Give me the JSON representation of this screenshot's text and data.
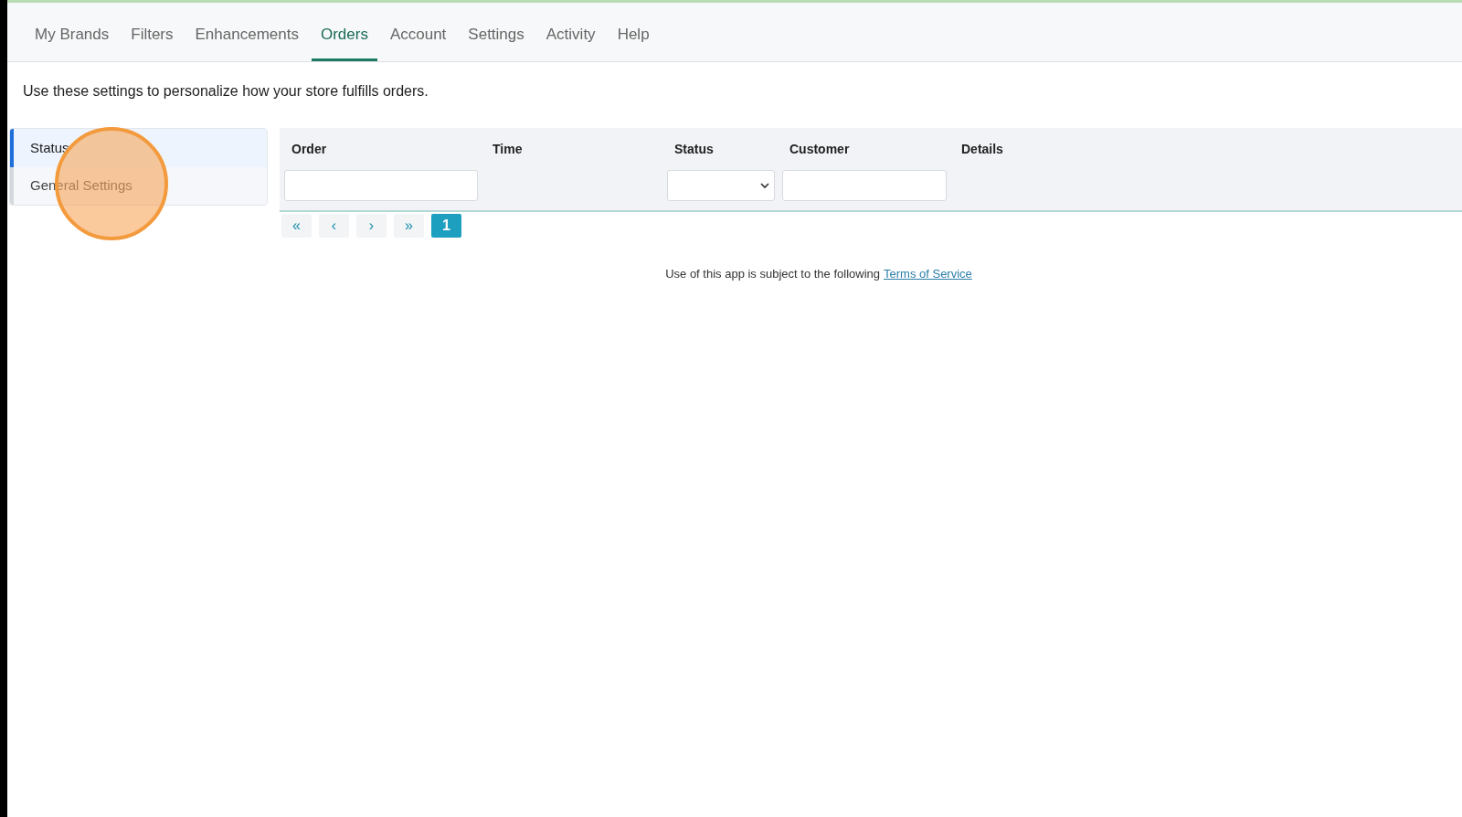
{
  "nav_tabs": [
    {
      "label": "My Brands",
      "selected": false
    },
    {
      "label": "Filters",
      "selected": false
    },
    {
      "label": "Enhancements",
      "selected": false
    },
    {
      "label": "Orders",
      "selected": true
    },
    {
      "label": "Account",
      "selected": false
    },
    {
      "label": "Settings",
      "selected": false
    },
    {
      "label": "Activity",
      "selected": false
    },
    {
      "label": "Help",
      "selected": false
    }
  ],
  "description": "Use these settings to personalize how your store fulfills orders.",
  "sidebar": {
    "items": [
      {
        "label": "Status",
        "selected": true
      },
      {
        "label": "General Settings",
        "selected": false
      }
    ]
  },
  "table": {
    "columns": [
      {
        "label": "Order",
        "kind": "text"
      },
      {
        "label": "Time",
        "kind": "plain"
      },
      {
        "label": "Status",
        "kind": "select"
      },
      {
        "label": "Customer",
        "kind": "text"
      },
      {
        "label": "Details",
        "kind": "plain"
      }
    ]
  },
  "pagination": [
    {
      "label": "«",
      "selected": false
    },
    {
      "label": "‹",
      "selected": false
    },
    {
      "label": "›",
      "selected": false
    },
    {
      "label": "»",
      "selected": false
    },
    {
      "label": "1",
      "selected": true
    }
  ],
  "footer": {
    "text": "Use of this app is subject to the following",
    "link": "Terms of Service"
  }
}
